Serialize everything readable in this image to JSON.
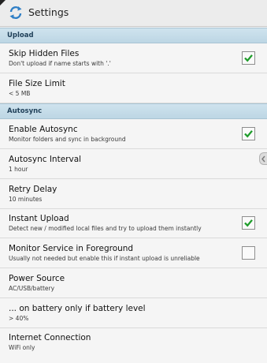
{
  "action_bar": {
    "title": "Settings",
    "icon": "sync-arrows-icon"
  },
  "colors": {
    "accent": "#2f7fc6",
    "check_green": "#1e9c2a",
    "section_bg": "#c6dde9"
  },
  "sections": {
    "upload": {
      "title": "Upload",
      "items": [
        {
          "title": "Skip Hidden Files",
          "summary": "Don't upload if name starts with '.'",
          "checked": true
        },
        {
          "title": "File Size Limit",
          "summary": "< 5 MB"
        }
      ]
    },
    "autosync": {
      "title": "Autosync",
      "items": [
        {
          "title": "Enable Autosync",
          "summary": "Monitor folders and sync in background",
          "checked": true
        },
        {
          "title": "Autosync Interval",
          "summary": "1 hour"
        },
        {
          "title": "Retry Delay",
          "summary": "10 minutes"
        },
        {
          "title": "Instant Upload",
          "summary": "Detect new / modified local files and try to upload them instantly",
          "checked": true
        },
        {
          "title": "Monitor Service in Foreground",
          "summary": "Usually not needed but enable this if instant upload is unreliable",
          "checked": false
        },
        {
          "title": "Power Source",
          "summary": "AC/USB/battery"
        },
        {
          "title": "... on battery only if battery level",
          "summary": "> 40%"
        },
        {
          "title": "Internet Connection",
          "summary": "WiFi only"
        }
      ]
    }
  }
}
